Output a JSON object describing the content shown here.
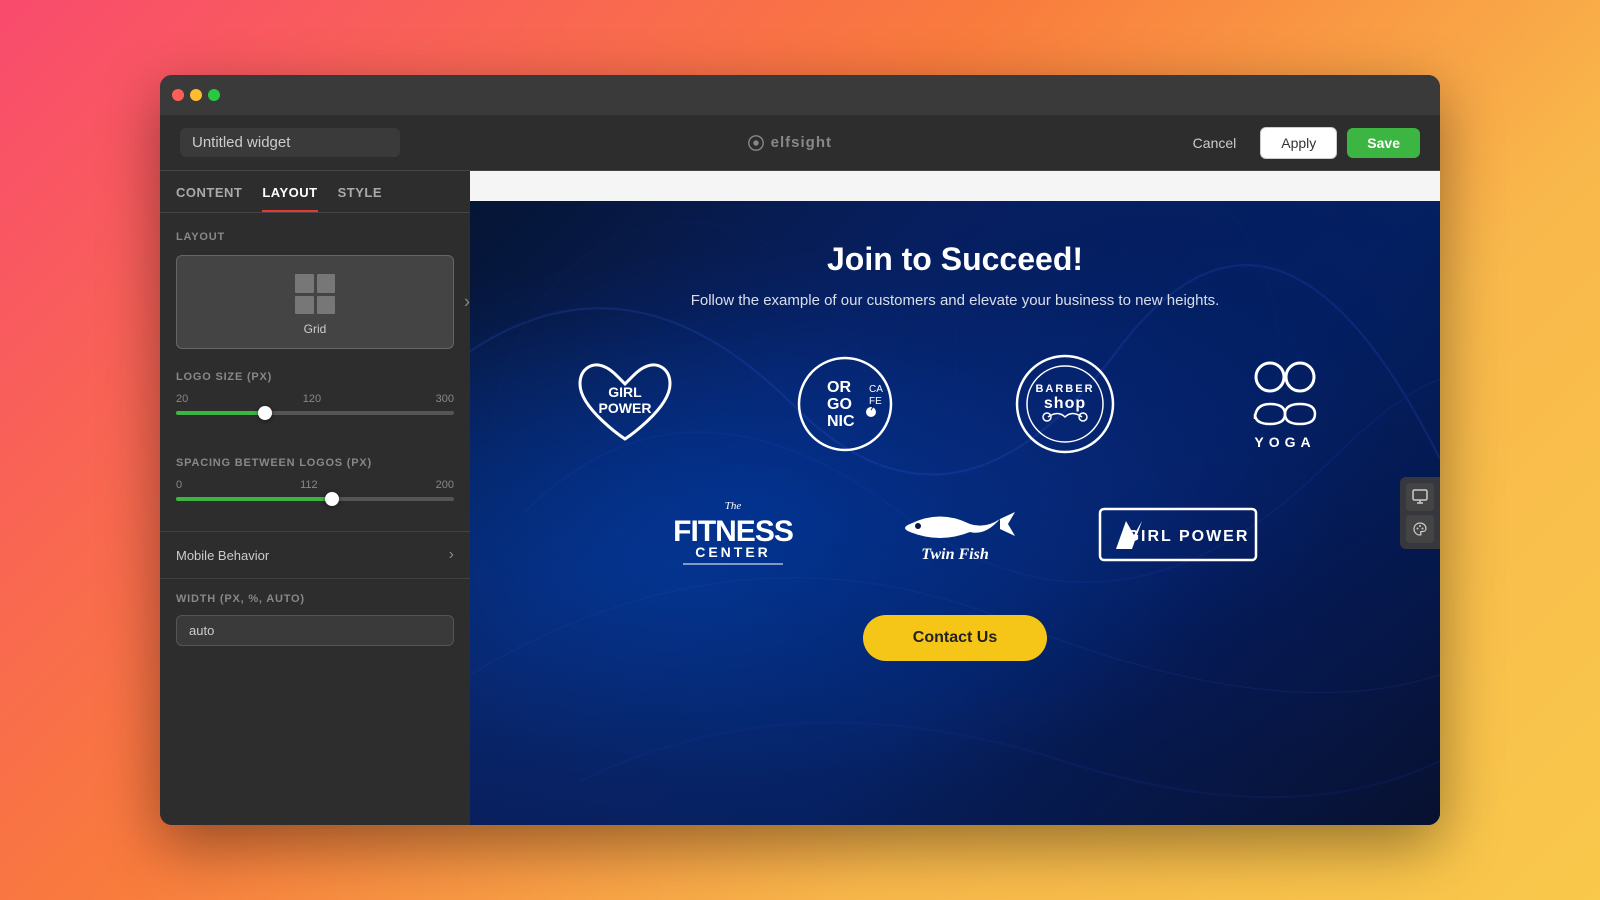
{
  "browser": {
    "traffic_lights": [
      "red",
      "yellow",
      "green"
    ]
  },
  "header": {
    "widget_title": "Untitled widget",
    "widget_title_placeholder": "Untitled widget",
    "logo_text": "elfsight",
    "cancel_label": "Cancel",
    "apply_label": "Apply",
    "save_label": "Save"
  },
  "sidebar": {
    "tabs": [
      {
        "id": "content",
        "label": "CONTENT",
        "active": false
      },
      {
        "id": "layout",
        "label": "LAYOUT",
        "active": true
      },
      {
        "id": "style",
        "label": "STYLE",
        "active": false
      }
    ],
    "layout_section_label": "LAYOUT",
    "layout_options": [
      {
        "id": "grid",
        "label": "Grid",
        "selected": true
      }
    ],
    "logo_size": {
      "label": "LOGO SIZE (PX)",
      "min": 20,
      "max": 300,
      "value": 120,
      "thumb_pct": 32
    },
    "spacing": {
      "label": "SPACING BETWEEN LOGOS (PX)",
      "min": 0,
      "max": 200,
      "value": 112,
      "thumb_pct": 56
    },
    "mobile_behavior_label": "Mobile Behavior",
    "width": {
      "label": "WIDTH (PX, %, AUTO)",
      "value": "auto"
    }
  },
  "preview": {
    "banner_visible": true,
    "title": "Join to Succeed!",
    "subtitle": "Follow the example of our customers and elevate your business to new heights.",
    "contact_button": "Contact Us",
    "logos_row1": [
      {
        "id": "girl-power-heart",
        "alt": "Girl Power Heart Logo"
      },
      {
        "id": "organic-cafe",
        "alt": "Organic Cafe Logo"
      },
      {
        "id": "barber-shop",
        "alt": "Barber Shop Logo"
      },
      {
        "id": "yoga",
        "alt": "Yoga Logo"
      }
    ],
    "logos_row2": [
      {
        "id": "fitness-center",
        "alt": "The Fitness Center Logo"
      },
      {
        "id": "twin-fish",
        "alt": "Twin Fish Logo"
      },
      {
        "id": "girl-power-lightning",
        "alt": "Girl Power Lightning Logo"
      }
    ]
  },
  "colors": {
    "active_tab_underline": "#e53935",
    "save_button": "#3db543",
    "contact_button": "#f5c518",
    "slider_fill": "#4a9eff"
  },
  "icons": {
    "chevron_right": "›",
    "monitor": "🖥",
    "palette": "🎨",
    "elfsight_symbol": "⊕"
  }
}
